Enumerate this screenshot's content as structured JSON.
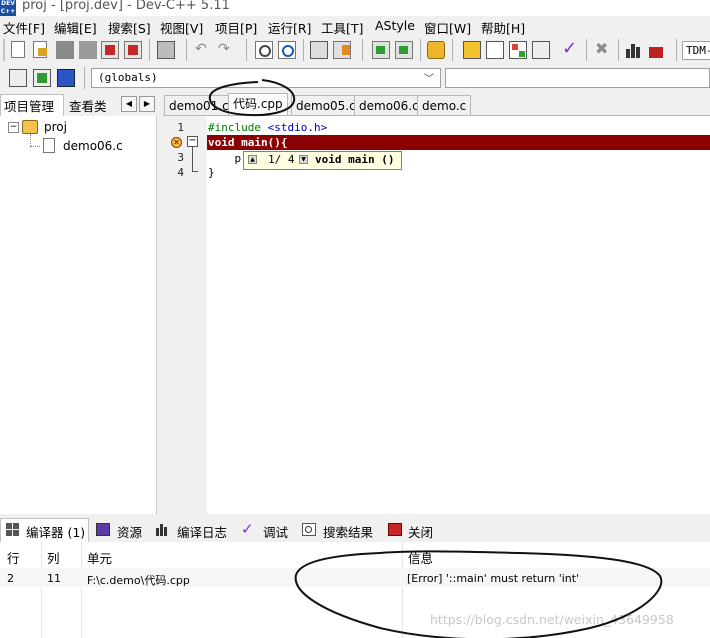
{
  "window": {
    "title": "proj - [proj.dev] - Dev-C++ 5.11",
    "icon_label": "DEV C++"
  },
  "menu": [
    "文件[F]",
    "编辑[E]",
    "搜索[S]",
    "视图[V]",
    "项目[P]",
    "运行[R]",
    "工具[T]",
    "AStyle",
    "窗口[W]",
    "帮助[H]"
  ],
  "toolbar": {
    "compiler_label": "TDM-"
  },
  "globals_combo": {
    "value": "(globals)"
  },
  "left_panel": {
    "tabs": [
      "项目管理",
      "查看类"
    ],
    "tree": {
      "project": "proj",
      "file": "demo06.c"
    }
  },
  "editor": {
    "tabs": [
      "demo01.c",
      "代码.cpp",
      "demo05.c",
      "demo06.c",
      "demo.c"
    ],
    "active_tab": "代码.cpp",
    "line_numbers": [
      "1",
      "2",
      "3",
      "4"
    ],
    "lines": {
      "l1_include": "#include ",
      "l1_header": "<stdio.h>",
      "l2": "void main(){",
      "l3": "    p",
      "l4": "}"
    },
    "tooltip": {
      "counter": "1/ 4",
      "signature": "void main ()"
    }
  },
  "bottom_tabs": [
    "编译器 (1)",
    "资源",
    "编译日志",
    "调试",
    "搜索结果",
    "关闭"
  ],
  "results": {
    "columns": [
      "行",
      "列",
      "单元",
      "信息"
    ],
    "rows": [
      {
        "line": "2",
        "col": "11",
        "unit": "F:\\c.demo\\代码.cpp",
        "message": "[Error] '::main' must return 'int'"
      }
    ]
  },
  "watermark": "https://blog.csdn.net/weixin_43649958",
  "colors": {
    "error_line": "#8b0000",
    "tooltip_bg": "#ffffe1",
    "include_green": "#008000"
  }
}
